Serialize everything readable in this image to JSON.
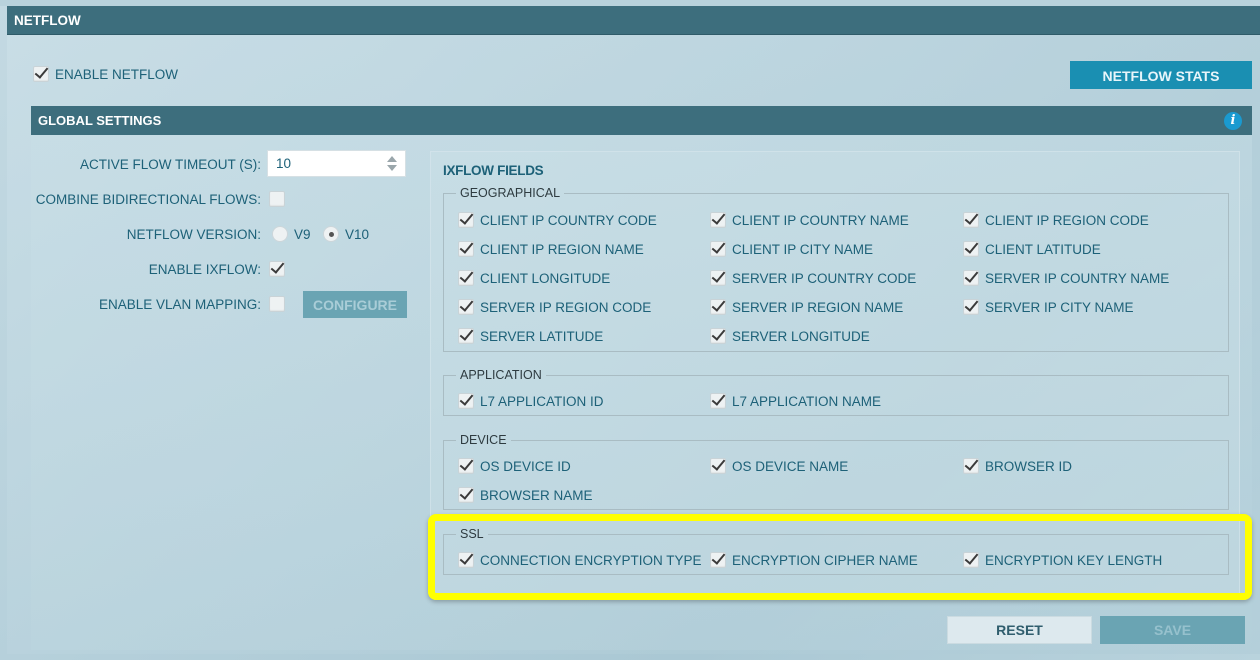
{
  "header": {
    "title": "NETFLOW"
  },
  "enable_netflow": {
    "label": "ENABLE NETFLOW",
    "checked": true
  },
  "netflow_stats_button": "NETFLOW STATS",
  "global_settings": {
    "title": "GLOBAL SETTINGS",
    "info_icon": "i",
    "active_flow_timeout": {
      "label": "ACTIVE FLOW TIMEOUT (S):",
      "value": "10"
    },
    "combine_bidirectional": {
      "label": "COMBINE BIDIRECTIONAL FLOWS:",
      "checked": false
    },
    "netflow_version": {
      "label": "NETFLOW VERSION:",
      "options": [
        "V9",
        "V10"
      ],
      "selected": "V10"
    },
    "enable_ixflow": {
      "label": "ENABLE IXFLOW:",
      "checked": true
    },
    "enable_vlan_mapping": {
      "label": "ENABLE VLAN MAPPING:",
      "checked": false
    },
    "configure_button": "CONFIGURE"
  },
  "ixflow": {
    "title": "IXFLOW FIELDS",
    "groups": [
      {
        "name": "GEOGRAPHICAL",
        "fields": [
          "CLIENT IP COUNTRY CODE",
          "CLIENT IP COUNTRY NAME",
          "CLIENT IP REGION CODE",
          "CLIENT IP REGION NAME",
          "CLIENT IP CITY NAME",
          "CLIENT LATITUDE",
          "CLIENT LONGITUDE",
          "SERVER IP COUNTRY CODE",
          "SERVER IP COUNTRY NAME",
          "SERVER IP REGION CODE",
          "SERVER IP REGION NAME",
          "SERVER IP CITY NAME",
          "SERVER LATITUDE",
          "SERVER LONGITUDE"
        ]
      },
      {
        "name": "APPLICATION",
        "fields": [
          "L7 APPLICATION ID",
          "L7 APPLICATION NAME"
        ]
      },
      {
        "name": "DEVICE",
        "fields": [
          "OS DEVICE ID",
          "OS DEVICE NAME",
          "BROWSER ID",
          "BROWSER NAME"
        ]
      },
      {
        "name": "SSL",
        "fields": [
          "CONNECTION ENCRYPTION TYPE",
          "ENCRYPTION CIPHER NAME",
          "ENCRYPTION KEY LENGTH"
        ]
      }
    ]
  },
  "footer": {
    "reset_label": "RESET",
    "save_label": "SAVE"
  },
  "colors": {
    "header_bg": "#3d6e7d",
    "accent_button": "#1a8fb2",
    "highlight": "#ffff00",
    "text": "#1d6178"
  }
}
